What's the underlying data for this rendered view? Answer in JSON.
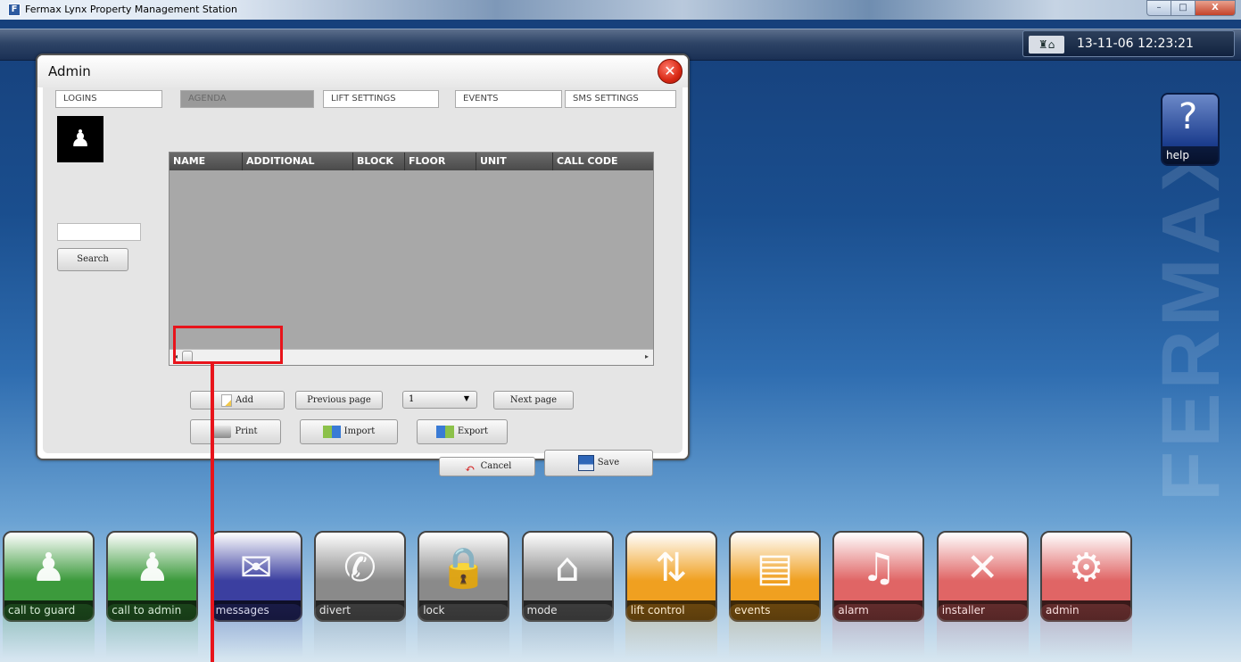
{
  "window": {
    "title": "Fermax Lynx Property Management Station",
    "controls": {
      "minimize": "–",
      "maximize": "□",
      "close": "X"
    }
  },
  "status": {
    "datetime": "13-11-06 12:23:21",
    "icon": "guard-house-icon"
  },
  "brand": "FERMAX",
  "help": {
    "label": "help",
    "glyph": "?"
  },
  "dialog": {
    "title": "Admin",
    "tabs": [
      "LOGINS",
      "AGENDA",
      "LIFT SETTINGS",
      "EVENTS",
      "SMS SETTINGS"
    ],
    "active_tab": "AGENDA",
    "search": {
      "value": "",
      "button": "Search"
    },
    "table": {
      "columns": [
        "NAME",
        "ADDITIONAL",
        "BLOCK",
        "FLOOR",
        "UNIT",
        "CALL CODE"
      ],
      "rows": []
    },
    "buttons": {
      "add": "Add",
      "previous": "Previous page",
      "page": "1",
      "next": "Next page",
      "print": "Print",
      "import": "Import",
      "export": "Export",
      "cancel": "Cancel",
      "save": "Save"
    }
  },
  "launcher": [
    {
      "label": "call to guard",
      "color": "#3c9a3c",
      "icon": "guard-icon"
    },
    {
      "label": "call to admin",
      "color": "#3c9a3c",
      "icon": "admin-call-icon"
    },
    {
      "label": "messages",
      "color": "#3b3fa0",
      "icon": "envelope-icon"
    },
    {
      "label": "divert",
      "color": "#8a8a8a",
      "icon": "phone-divert-icon"
    },
    {
      "label": "lock",
      "color": "#8a8a8a",
      "icon": "lock-icon"
    },
    {
      "label": "mode",
      "color": "#8a8a8a",
      "icon": "house-gear-icon"
    },
    {
      "label": "lift control",
      "color": "#f0a020",
      "icon": "elevator-icon"
    },
    {
      "label": "events",
      "color": "#f0a020",
      "icon": "documents-icon"
    },
    {
      "label": "alarm",
      "color": "#e06565",
      "icon": "bell-icon"
    },
    {
      "label": "installer",
      "color": "#e06565",
      "icon": "tools-icon"
    },
    {
      "label": "admin",
      "color": "#e06565",
      "icon": "admin-gear-icon"
    }
  ]
}
